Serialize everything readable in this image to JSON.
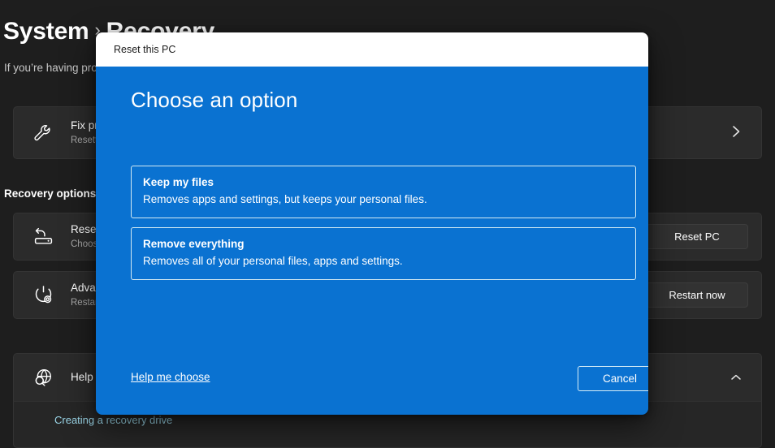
{
  "settings": {
    "breadcrumb": {
      "parent": "System",
      "separator": "›",
      "current": "Recovery"
    },
    "subtitle": "If you’re having problems with your PC or want to reset it, these recovery options might help",
    "rows": [
      {
        "id": "fix-problems",
        "icon": "wrench-icon",
        "title": "Fix problems without resetting your PC",
        "subtitle": "Resetting can take a while — first try resolving issues by running a troubleshooter",
        "action": "chevron-right"
      },
      {
        "id": "reset-this-pc",
        "icon": "reset-pc-icon",
        "title": "Reset this PC",
        "subtitle": "Choose to keep or remove your personal files, then reinstall Windows",
        "action": "button",
        "button_label": "Reset PC"
      },
      {
        "id": "advanced-startup",
        "icon": "advanced-startup-icon",
        "title": "Advanced startup",
        "subtitle": "Restart your device to change startup settings, including starting from a disc or USB drive",
        "action": "button",
        "button_label": "Restart now"
      }
    ],
    "section_heading": "Recovery options",
    "help": {
      "icon": "globe-search-icon",
      "title": "Help with Recovery",
      "action": "chevron-up",
      "links": [
        "Creating a recovery drive"
      ]
    }
  },
  "dialog": {
    "title": "Reset this PC",
    "heading": "Choose an option",
    "options": [
      {
        "id": "keep-my-files",
        "title": "Keep my files",
        "description": "Removes apps and settings, but keeps your personal files."
      },
      {
        "id": "remove-everything",
        "title": "Remove everything",
        "description": "Removes all of your personal files, apps and settings."
      }
    ],
    "help_link": "Help me choose",
    "cancel_label": "Cancel"
  },
  "colors": {
    "dialog_blue": "#0a72d1",
    "dialog_border": "#d3eaf3",
    "page_background": "#1e1e1e",
    "card_background": "#2b2b2b",
    "link_blue": "#9bd6e8"
  }
}
